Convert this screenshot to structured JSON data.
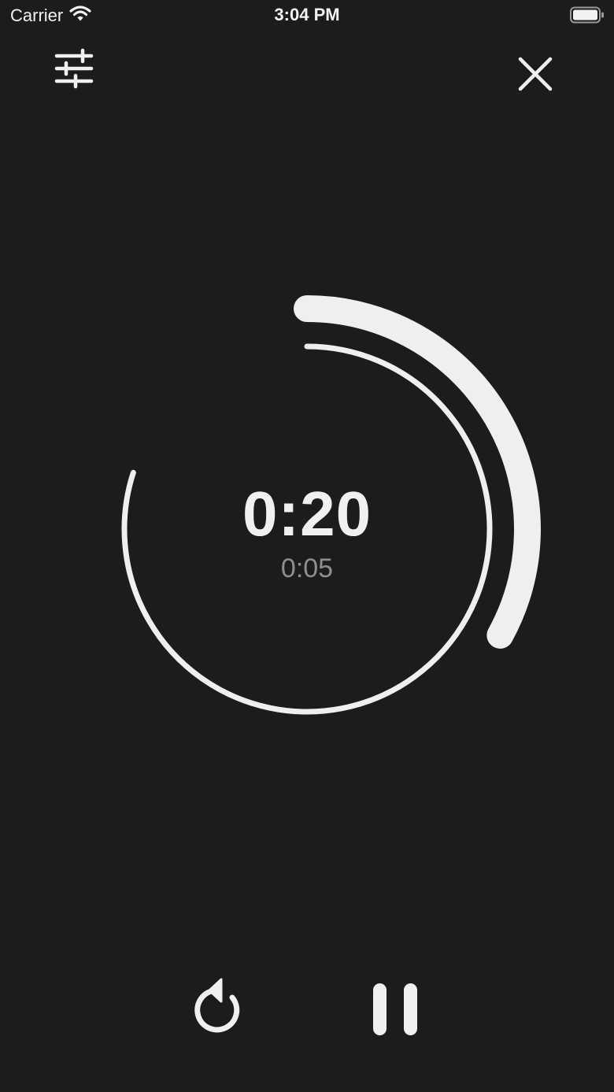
{
  "status_bar": {
    "carrier": "Carrier",
    "time": "3:04 PM",
    "wifi_icon": "wifi-icon",
    "battery_icon": "battery-icon"
  },
  "header": {
    "settings_icon": "sliders-icon",
    "close_icon": "close-icon"
  },
  "timer": {
    "main": "0:20",
    "sub": "0:05",
    "outer_progress": 0.33,
    "inner_progress": 0.8
  },
  "controls": {
    "reset_icon": "reset-icon",
    "pause_icon": "pause-icon"
  },
  "colors": {
    "background": "#1c1c1e",
    "foreground": "#f0f0f0",
    "secondary_text": "#8e8e8e"
  }
}
